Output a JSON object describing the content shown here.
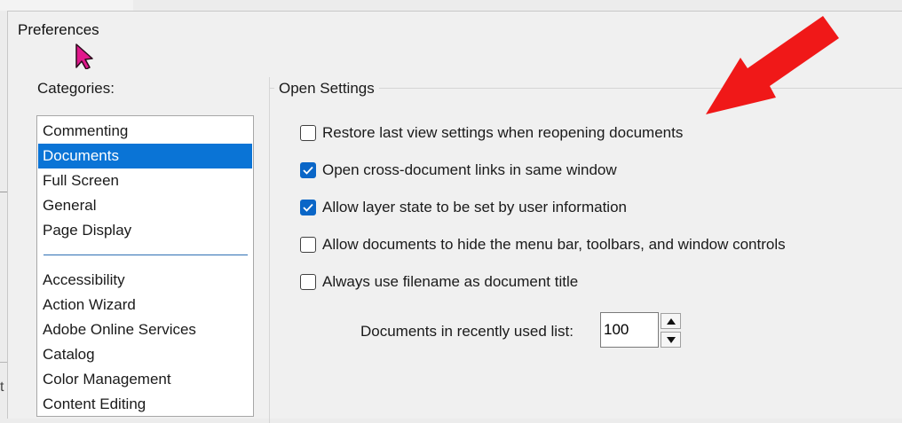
{
  "dialog": {
    "title": "Preferences"
  },
  "categories": {
    "label": "Categories:",
    "group1": [
      {
        "label": "Commenting",
        "selected": false
      },
      {
        "label": "Documents",
        "selected": true
      },
      {
        "label": "Full Screen",
        "selected": false
      },
      {
        "label": "General",
        "selected": false
      },
      {
        "label": "Page Display",
        "selected": false
      }
    ],
    "group2": [
      {
        "label": "Accessibility"
      },
      {
        "label": "Action Wizard"
      },
      {
        "label": "Adobe Online Services"
      },
      {
        "label": "Catalog"
      },
      {
        "label": "Color Management"
      },
      {
        "label": "Content Editing"
      }
    ]
  },
  "open_settings": {
    "group_label": "Open Settings",
    "options": [
      {
        "label": "Restore last view settings when reopening documents",
        "checked": false
      },
      {
        "label": "Open cross-document links in same window",
        "checked": true
      },
      {
        "label": "Allow layer state to be set by user information",
        "checked": true
      },
      {
        "label": "Allow documents to hide the menu bar, toolbars, and window controls",
        "checked": false
      },
      {
        "label": "Always use filename as document title",
        "checked": false
      }
    ],
    "recent_list_label": "Documents in recently used list:",
    "recent_list_value": "100"
  },
  "colors": {
    "selection": "#0a74d6",
    "checkbox_checked": "#0a66c7",
    "annotation_arrow": "#f01818",
    "cursor": "#e0188c"
  },
  "icons": {
    "cursor": "mouse-pointer-icon",
    "annotation": "red-arrow-icon",
    "checkmark": "checkmark-icon",
    "spin_up": "triangle-up-icon",
    "spin_down": "triangle-down-icon"
  },
  "behind_window_glyph": "t"
}
